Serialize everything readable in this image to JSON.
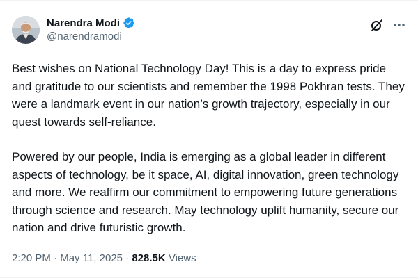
{
  "author": {
    "display_name": "Narendra Modi",
    "handle": "@narendramodi",
    "verified": true
  },
  "icons": {
    "avatar": "profile-photo",
    "verified": "verified-badge-icon",
    "grok": "grok-icon",
    "more": "more-options-icon"
  },
  "colors": {
    "text": "#0f1419",
    "secondary": "#536471",
    "verified_blue": "#1d9bf0"
  },
  "tweet": {
    "paragraph_1": "Best wishes on National Technology Day! This is a day to express pride and gratitude to our scientists and remember the 1998 Pokhran tests. They were a landmark event in our nation’s growth trajectory, especially in our quest towards self-reliance.",
    "paragraph_2": "Powered by our people, India is emerging as a global leader in different aspects of technology, be it space, AI, digital innovation, green technology and more. We reaffirm our commitment to empowering future generations through science and research. May technology uplift humanity, secure our nation and drive futuristic growth."
  },
  "meta": {
    "time": "2:20 PM",
    "separator": "·",
    "date": "May 11, 2025",
    "views_count": "828.5K",
    "views_label": "Views"
  }
}
